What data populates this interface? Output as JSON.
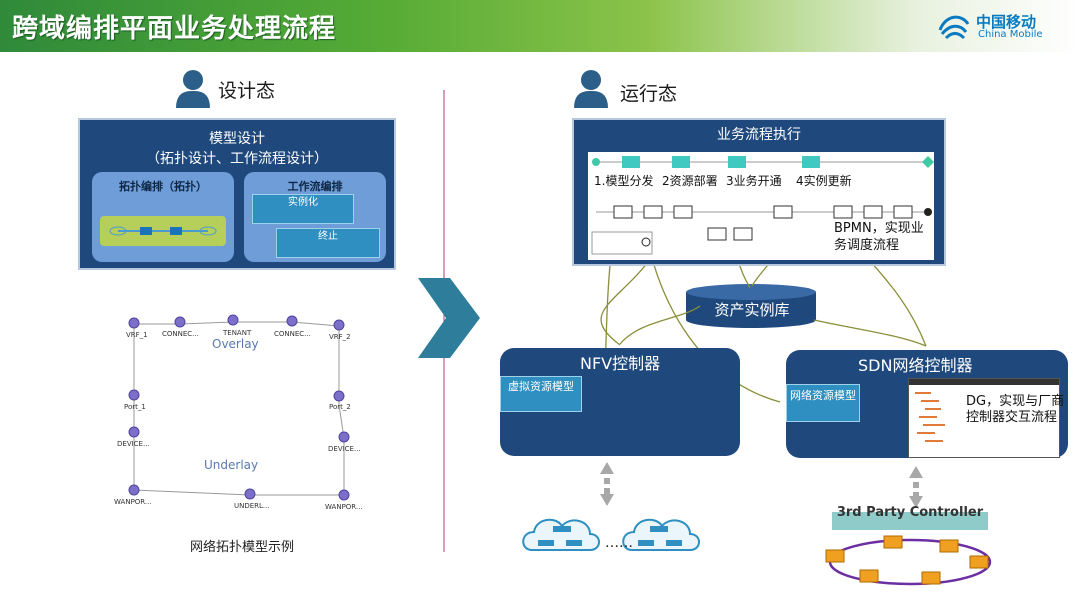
{
  "header": {
    "title": "跨域编排平面业务处理流程"
  },
  "logo": {
    "cn": "中国移动",
    "en": "China Mobile"
  },
  "design": {
    "person_label": "设计态",
    "model_title": "模型设计",
    "model_subtitle": "（拓扑设计、工作流程设计）",
    "topology_label": "拓扑编排（拓扑）",
    "workflow_label": "工作流编排",
    "wf_tab1": "实例化",
    "wf_tab2": "终止"
  },
  "topology": {
    "nodes": [
      "VRF_1",
      "CONNEC...",
      "TENANT",
      "CONNEC...",
      "VRF_2",
      "Port_1",
      "Port_2",
      "DEVICE...",
      "DEVICE...",
      "WANPOR...",
      "UNDERL...",
      "WANPOR..."
    ],
    "overlay": "Overlay",
    "underlay": "Underlay",
    "caption": "网络拓扑模型示例"
  },
  "runtime": {
    "person_label": "运行态",
    "exec_title": "业务流程执行",
    "steps": [
      "1.模型分发",
      "2资源部署",
      "3业务开通",
      "4实例更新"
    ],
    "bpmn_text": "BPMN，实现业务调度流程",
    "db_label": "资产实例库",
    "nfv_title": "NFV控制器",
    "nfv_model": "虚拟资源模型",
    "sdn_title": "SDN网络控制器",
    "sdn_model": "网络资源模型",
    "dg_text": "DG，实现与厂商控制器交互流程",
    "third_party": "3rd Party Controller",
    "ellipsis": "……"
  },
  "colors": {
    "header_green": "#2f8a3a",
    "navy": "#1f497d",
    "accent_blue": "#2e8fc0",
    "arrow_teal": "#2e7d9a",
    "flow_olive": "#8a8f3a"
  }
}
